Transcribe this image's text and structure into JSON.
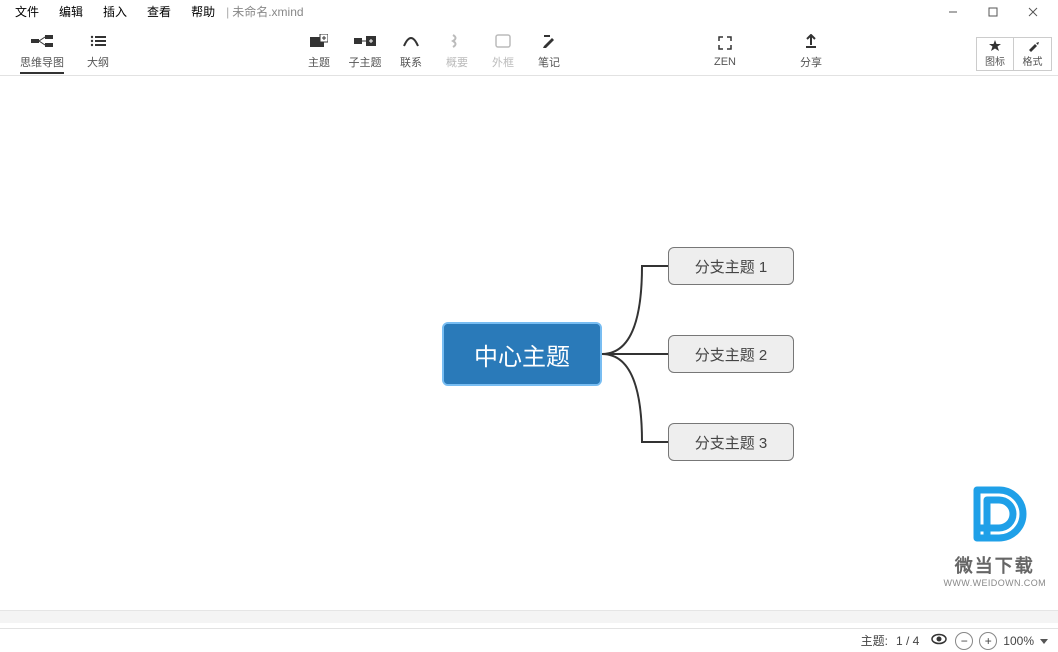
{
  "menubar": {
    "items": [
      "文件",
      "编辑",
      "插入",
      "查看",
      "帮助"
    ],
    "title": "未命名.xmind"
  },
  "toolbar": {
    "left": [
      {
        "label": "思维导图",
        "icon": "mindmap",
        "active": true
      },
      {
        "label": "大纲",
        "icon": "outline"
      }
    ],
    "center": [
      {
        "label": "主题",
        "icon": "topic"
      },
      {
        "label": "子主题",
        "icon": "subtopic"
      },
      {
        "label": "联系",
        "icon": "relation"
      },
      {
        "label": "概要",
        "icon": "summary",
        "disabled": true
      },
      {
        "label": "外框",
        "icon": "boundary",
        "disabled": true
      },
      {
        "label": "笔记",
        "icon": "notes"
      }
    ],
    "extra": [
      {
        "label": "ZEN",
        "icon": "zen"
      },
      {
        "label": "分享",
        "icon": "share"
      }
    ],
    "right": [
      {
        "label": "图标",
        "icon": "star"
      },
      {
        "label": "格式",
        "icon": "format"
      }
    ]
  },
  "mindmap": {
    "central": "中心主题",
    "branches": [
      "分支主题 1",
      "分支主题 2",
      "分支主题 3"
    ]
  },
  "statusbar": {
    "topic_label": "主题:",
    "topic_value": "1 / 4",
    "zoom": "100%"
  },
  "watermark": {
    "line1": "微当下载",
    "line2": "WWW.WEIDOWN.COM"
  }
}
